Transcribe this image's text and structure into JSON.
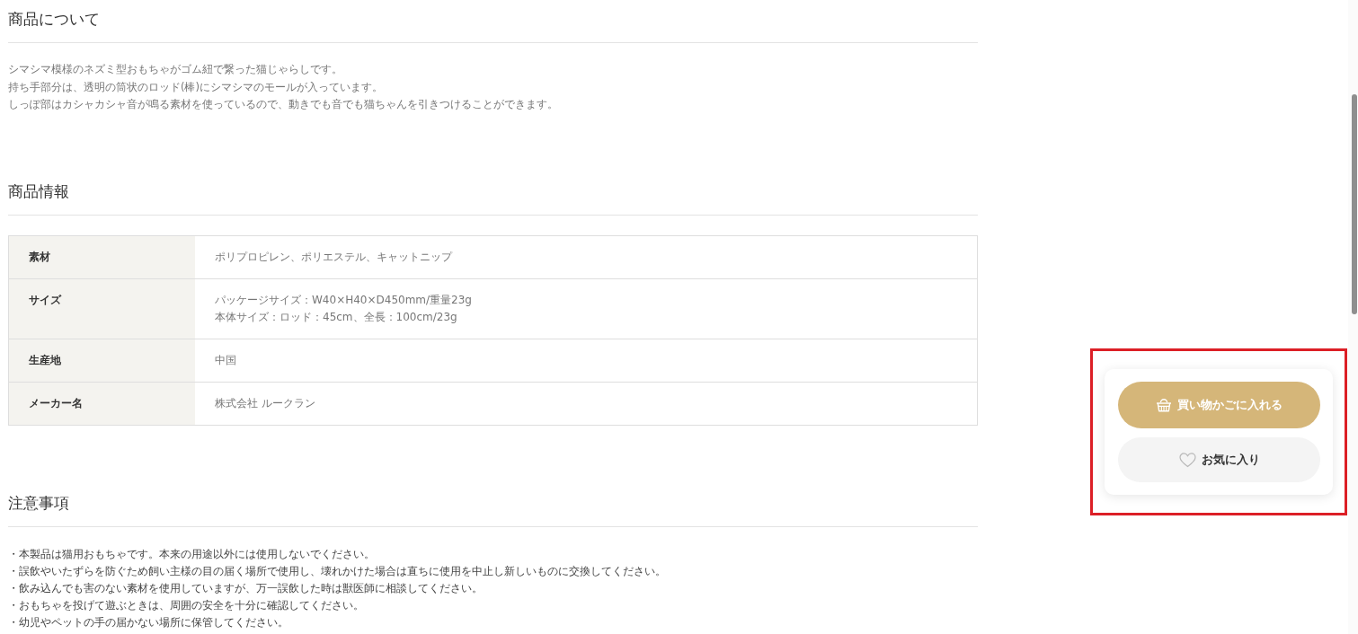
{
  "sections": [
    {
      "kind": "text",
      "heading": "商品について",
      "lines": [
        "シマシマ模様のネズミ型おもちゃがゴム紐で繋った猫じゃらしです。",
        "持ち手部分は、透明の筒状のロッド(棒)にシマシマのモールが入っています。",
        "しっぽ部はカシャカシャ音が鳴る素材を使っているので、動きでも音でも猫ちゃんを引きつけることができます。"
      ]
    },
    {
      "kind": "table",
      "heading": "商品情報",
      "rows": [
        {
          "label": "素材",
          "values": [
            "ポリプロピレン、ポリエステル、キャットニップ"
          ]
        },
        {
          "label": "サイズ",
          "values": [
            "パッケージサイズ：W40×H40×D450mm/重量23g",
            "本体サイズ：ロッド：45cm、全長：100cm/23g"
          ]
        },
        {
          "label": "生産地",
          "values": [
            "中国"
          ]
        },
        {
          "label": "メーカー名",
          "values": [
            "株式会社 ルークラン"
          ]
        }
      ]
    },
    {
      "kind": "notes",
      "heading": "注意事項",
      "lines": [
        "・本製品は猫用おもちゃです。本来の用途以外には使用しないでください。",
        "・誤飲やいたずらを防ぐため飼い主様の目の届く場所で使用し、壊れかけた場合は直ちに使用を中止し新しいものに交換してください。",
        "・飲み込んでも害のない素材を使用していますが、万一誤飲した時は獣医師に相談してください。",
        "・おもちゃを投げて遊ぶときは、周囲の安全を十分に確認してください。",
        "・幼児やペットの手の届かない場所に保管してください。"
      ]
    }
  ],
  "purchase_panel": {
    "highlighted": true,
    "buttons": [
      {
        "kind": "cart",
        "label": "買い物かごに入れる"
      },
      {
        "kind": "favorite",
        "label": "お気に入り"
      }
    ]
  }
}
